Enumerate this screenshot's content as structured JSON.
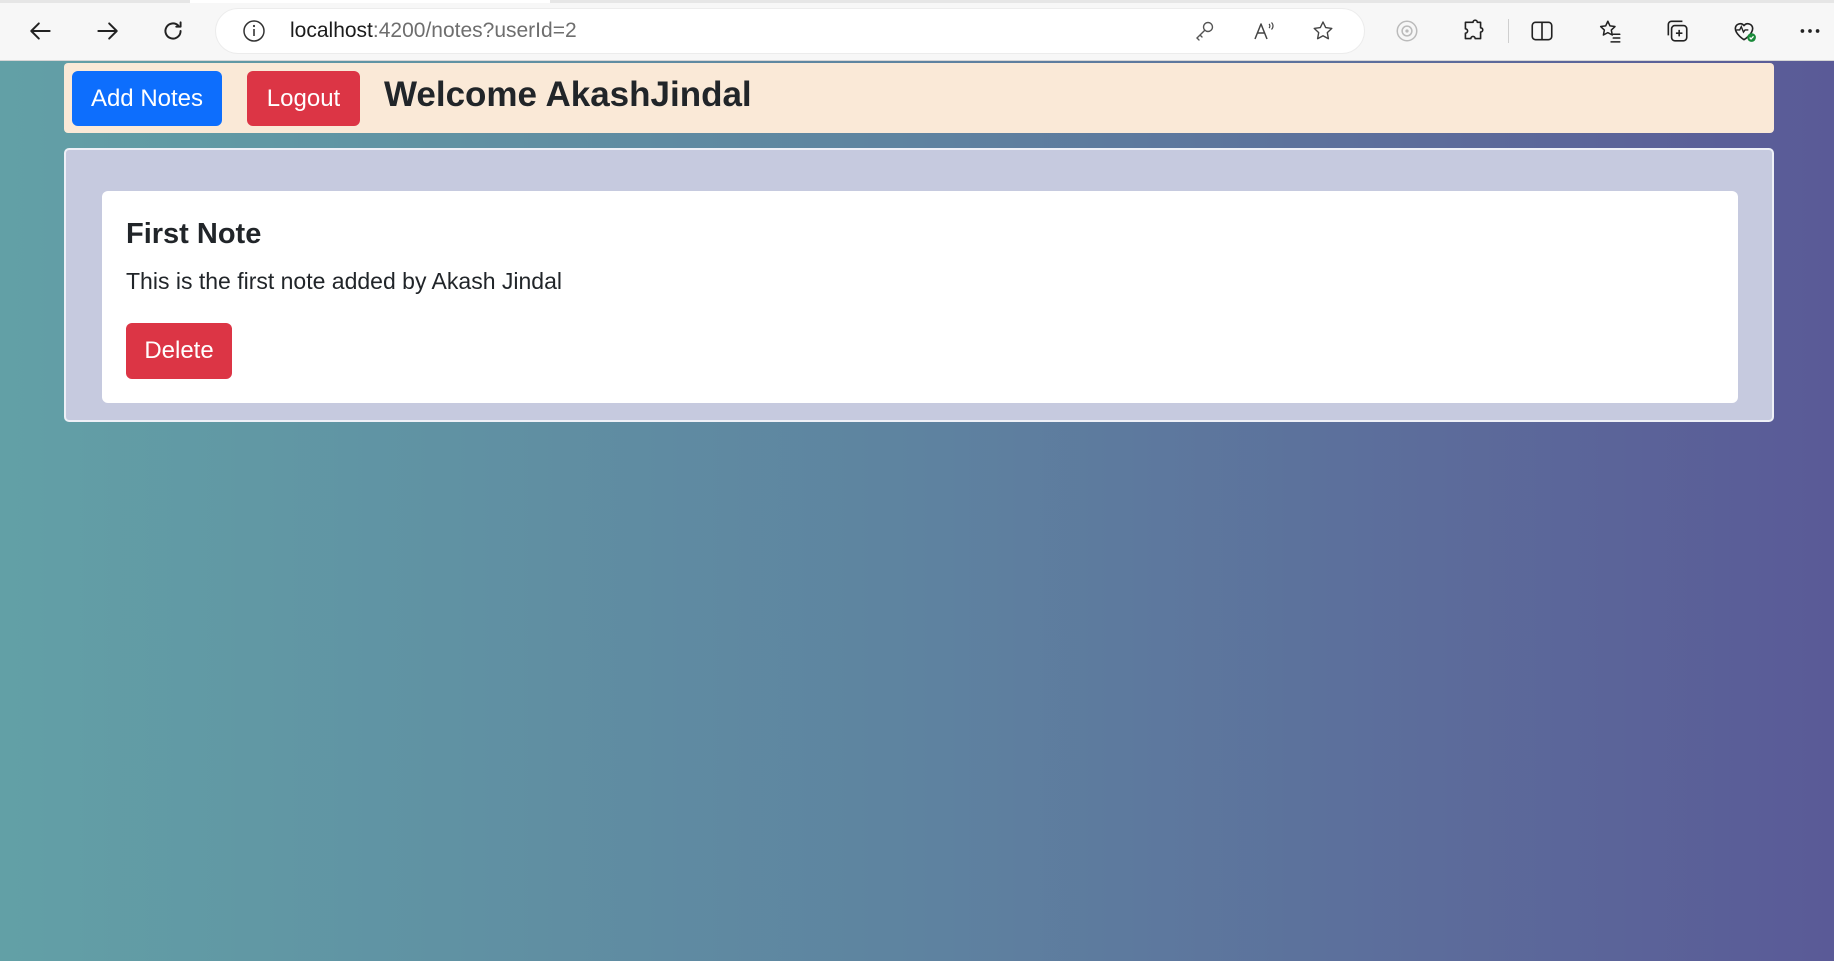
{
  "browser": {
    "url_host": "localhost",
    "url_path": ":4200/notes?userId=2"
  },
  "header": {
    "add_notes_label": "Add Notes",
    "logout_label": "Logout",
    "welcome_text": "Welcome AkashJindal"
  },
  "notes": [
    {
      "title": "First Note",
      "body": "This is the first note added by Akash Jindal",
      "delete_label": "Delete"
    }
  ],
  "icons": {
    "back": "arrow-left-icon",
    "forward": "arrow-right-icon",
    "refresh": "refresh-icon",
    "site_info": "info-icon",
    "password_key": "key-icon",
    "read_aloud": "read-aloud-icon",
    "favorite_add": "star-icon",
    "tracking": "tracking-prevention-icon",
    "extensions": "puzzle-icon",
    "split_screen": "split-screen-icon",
    "favorites": "favorites-icon",
    "collections": "collections-icon",
    "browser_essentials": "heart-pulse-icon",
    "more": "more-icon"
  },
  "colors": {
    "primary": "#0d6efd",
    "danger": "#dc3545",
    "topbar_bg": "#fae9d7",
    "container_bg": "#c6cadf",
    "gradient_left": "#62a0a6",
    "gradient_right": "#5a5a97"
  }
}
